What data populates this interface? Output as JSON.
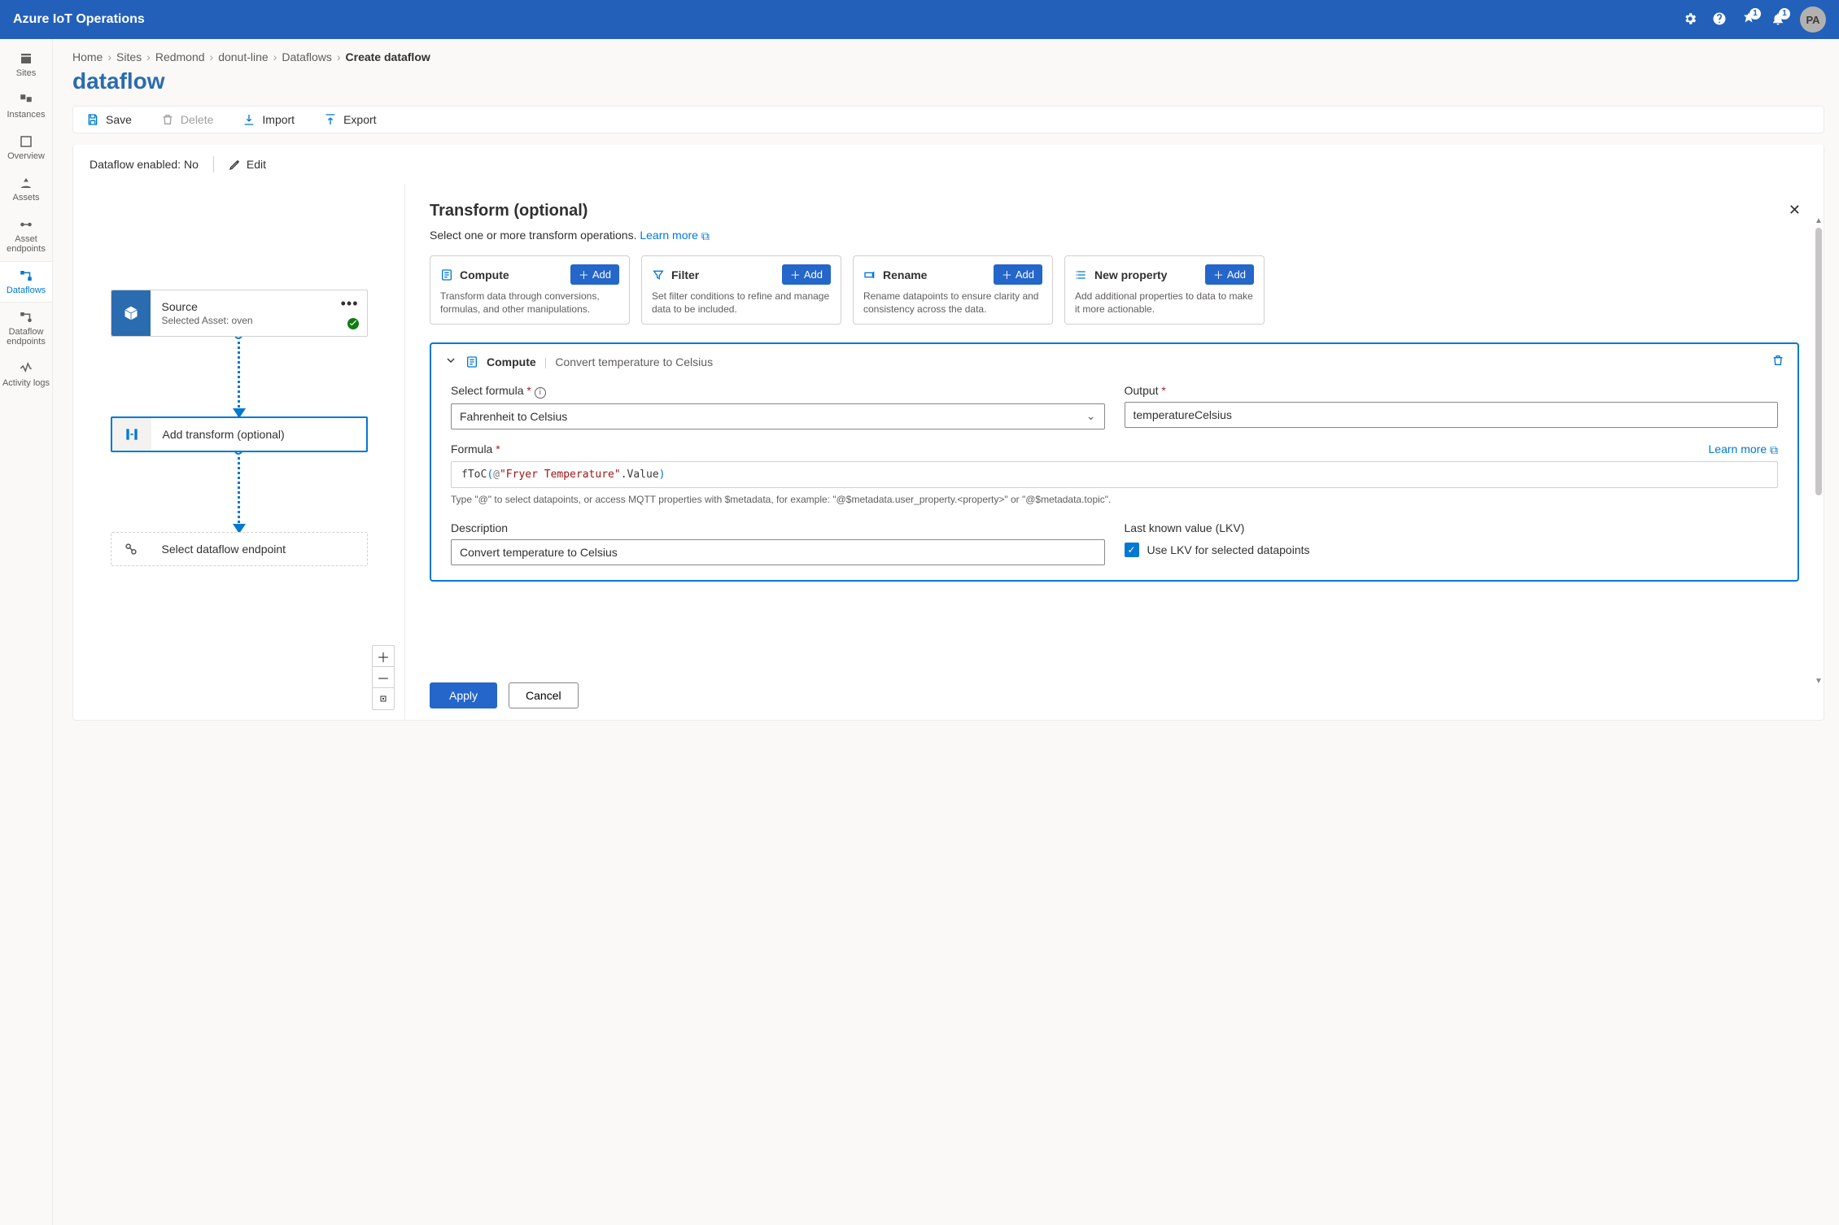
{
  "header": {
    "app_title": "Azure IoT Operations",
    "notif_badge": "1",
    "notif2_badge": "1",
    "avatar_initials": "PA"
  },
  "nav": {
    "items": [
      {
        "label": "Sites"
      },
      {
        "label": "Instances"
      },
      {
        "label": "Overview"
      },
      {
        "label": "Assets"
      },
      {
        "label": "Asset endpoints"
      },
      {
        "label": "Dataflows"
      },
      {
        "label": "Dataflow endpoints"
      },
      {
        "label": "Activity logs"
      }
    ],
    "selected_index": 5
  },
  "breadcrumb": {
    "items": [
      "Home",
      "Sites",
      "Redmond",
      "donut-line",
      "Dataflows"
    ],
    "current": "Create dataflow"
  },
  "page": {
    "title": "dataflow"
  },
  "toolbar": {
    "save": "Save",
    "delete": "Delete",
    "import": "Import",
    "export": "Export"
  },
  "enabled_bar": {
    "label": "Dataflow enabled:",
    "value": "No",
    "edit": "Edit"
  },
  "flow": {
    "source": {
      "title": "Source",
      "subtitle": "Selected Asset: oven"
    },
    "transform": {
      "title": "Add transform (optional)"
    },
    "endpoint": {
      "title": "Select dataflow endpoint"
    }
  },
  "panel": {
    "title": "Transform (optional)",
    "intro": "Select one or more transform operations.",
    "learn_more": "Learn more",
    "ops": {
      "compute": {
        "title": "Compute",
        "add": "Add",
        "desc": "Transform data through conversions, formulas, and other manipulations."
      },
      "filter": {
        "title": "Filter",
        "add": "Add",
        "desc": "Set filter conditions to refine and manage data to be included."
      },
      "rename": {
        "title": "Rename",
        "add": "Add",
        "desc": "Rename datapoints to ensure clarity and consistency across the data."
      },
      "newprop": {
        "title": "New property",
        "add": "Add",
        "desc": "Add additional properties to data to make it more actionable."
      }
    },
    "compute_block": {
      "header_label": "Compute",
      "header_name": "Convert temperature to Celsius",
      "select_formula_label": "Select formula",
      "select_formula_value": "Fahrenheit to Celsius",
      "output_label": "Output",
      "output_value": "temperatureCelsius",
      "formula_label": "Formula",
      "learn_more": "Learn more",
      "formula_fn": "fToC",
      "formula_at": "@",
      "formula_str": "\"Fryer Temperature\"",
      "formula_prop": ".Value",
      "hint": "Type \"@\" to select datapoints, or access MQTT properties with $metadata, for example: \"@$metadata.user_property.<property>\" or \"@$metadata.topic\".",
      "description_label": "Description",
      "description_value": "Convert temperature to Celsius",
      "lkv_label": "Last known value (LKV)",
      "lkv_checkbox_label": "Use LKV for selected datapoints"
    },
    "footer": {
      "apply": "Apply",
      "cancel": "Cancel"
    }
  }
}
